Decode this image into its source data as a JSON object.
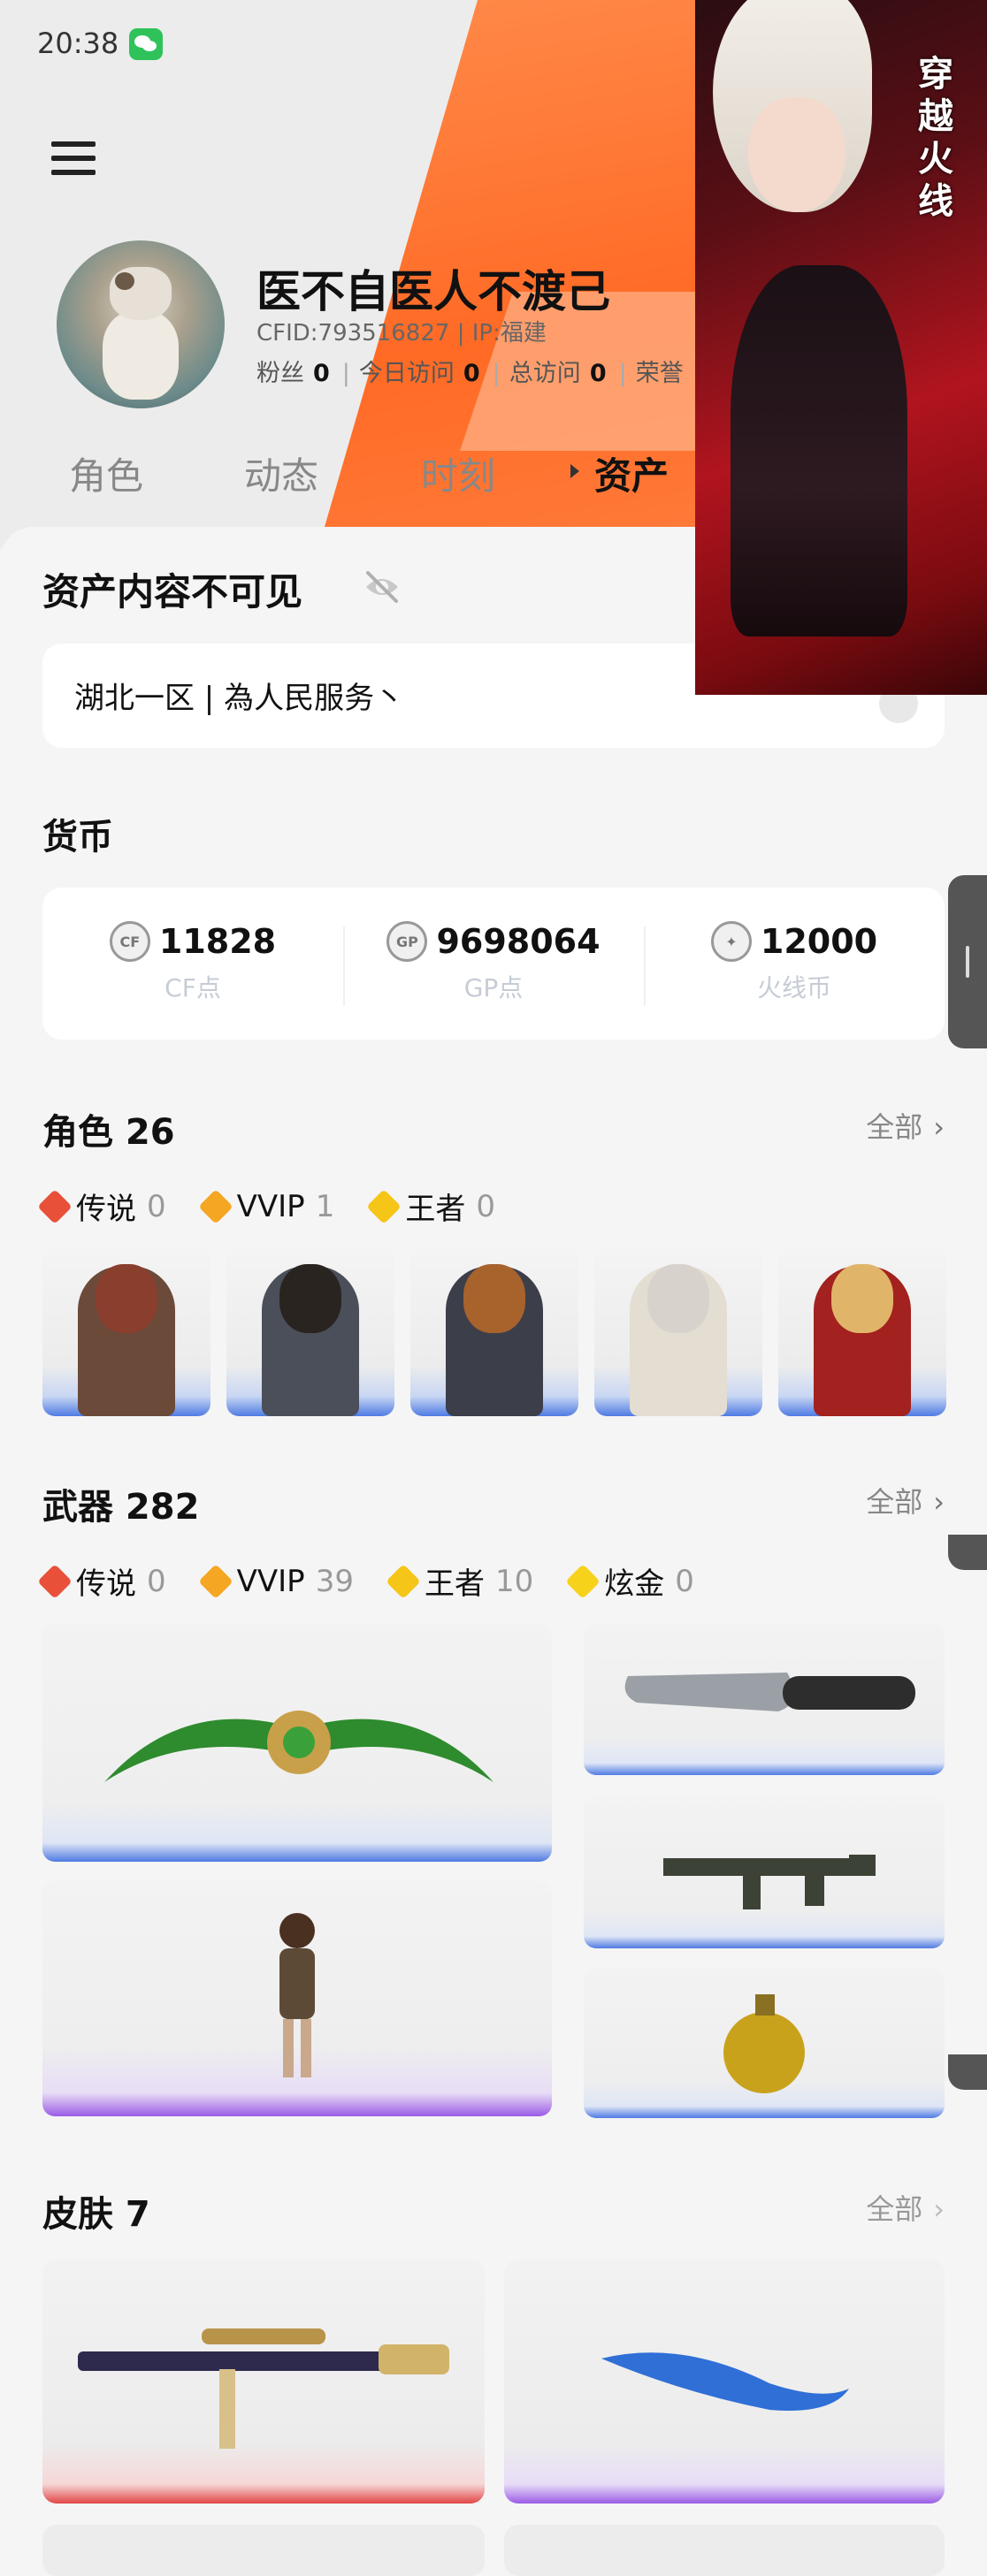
{
  "status_bar": {
    "time": "20:38"
  },
  "profile": {
    "name": "医不自医人不渡己",
    "cfid_line": "CFID:793516827 | IP:福建",
    "stats": [
      {
        "label": "粉丝",
        "value": "0"
      },
      {
        "label": "今日访问",
        "value": "0"
      },
      {
        "label": "总访问",
        "value": "0"
      },
      {
        "label": "荣誉",
        "value": ""
      }
    ]
  },
  "tabs": [
    {
      "label": "角色",
      "active": false
    },
    {
      "label": "动态",
      "active": false
    },
    {
      "label": "时刻",
      "active": false
    },
    {
      "label": "资产",
      "active": true
    }
  ],
  "assets": {
    "hidden_notice": "资产内容不可见",
    "server": "湖北一区 | 為人民服务丶"
  },
  "currency": {
    "title": "货币",
    "items": [
      {
        "icon": "cf-coin-icon",
        "value": "11828",
        "label": "CF点"
      },
      {
        "icon": "gp-coin-icon",
        "value": "9698064",
        "label": "GP点"
      },
      {
        "icon": "fire-coin-icon",
        "value": "12000",
        "label": "火线币"
      }
    ]
  },
  "roles": {
    "title": "角色 26",
    "all_label": "全部",
    "rarities": [
      {
        "label": "传说",
        "count": "0",
        "color": "#e8503a"
      },
      {
        "label": "VVIP",
        "count": "1",
        "color": "#f5a623"
      },
      {
        "label": "王者",
        "count": "0",
        "color": "#f5c518"
      }
    ]
  },
  "weapons": {
    "title": "武器 282",
    "all_label": "全部",
    "rarities": [
      {
        "label": "传说",
        "count": "0",
        "color": "#e8503a"
      },
      {
        "label": "VVIP",
        "count": "39",
        "color": "#f5a623"
      },
      {
        "label": "王者",
        "count": "10",
        "color": "#f5c518"
      },
      {
        "label": "炫金",
        "count": "0",
        "color": "#f7d21a"
      }
    ]
  },
  "skins": {
    "title": "皮肤 7",
    "all_label": "全部"
  },
  "overlay": {
    "logo_text": "穿越火线"
  },
  "colors": {
    "accent_orange": "#ff6a25",
    "rarity_blue": "#4f7be3",
    "rarity_purple": "#9a5ce6"
  }
}
